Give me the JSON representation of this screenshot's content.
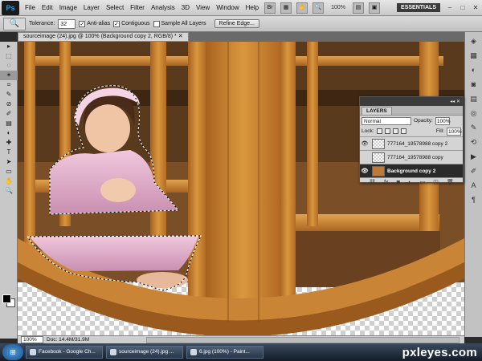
{
  "app": {
    "logo": "Ps",
    "menus": [
      "File",
      "Edit",
      "Image",
      "Layer",
      "Select",
      "Filter",
      "Analysis",
      "3D",
      "View",
      "Window",
      "Help"
    ],
    "zoom_select": "100%",
    "workspace": "ESSENTIALS",
    "win_min": "–",
    "win_max": "□",
    "win_close": "✕",
    "icons": [
      "bridge-icon",
      "mini-bridge-icon",
      "hand-icon",
      "zoom-icon",
      "arrange-icon",
      "screen-mode-icon"
    ]
  },
  "options": {
    "tool_icon": "🔍",
    "tolerance_label": "Tolerance:",
    "tolerance_value": "32",
    "anti_alias_label": "Anti-alias",
    "anti_alias_checked": "✓",
    "contiguous_label": "Contiguous",
    "contiguous_checked": "✓",
    "sample_all_label": "Sample All Layers",
    "sample_all_checked": "",
    "refine_edge": "Refine Edge..."
  },
  "document": {
    "tab_title": "sourceimage (24).jpg @ 100% (Background copy 2, RGB/8) * ✕"
  },
  "tools": [
    "▸",
    "⬚",
    "◌",
    "✶",
    "⌗",
    "✎",
    "⊘",
    "✐",
    "▤",
    "◐",
    "✚",
    "T",
    "➤",
    "▭",
    "✋",
    "🔍"
  ],
  "layers_panel": {
    "collapse": "◂◂ ✕",
    "tab": "LAYERS",
    "blend_mode": "Normal",
    "opacity_label": "Opacity:",
    "opacity_value": "100%",
    "lock_label": "Lock:",
    "fill_label": "Fill:",
    "fill_value": "100%",
    "layers": [
      {
        "name": "777164_19578988 copy 2",
        "visible": "👁"
      },
      {
        "name": "777164_19578988 copy",
        "visible": ""
      },
      {
        "name": "Background copy 2",
        "visible": "👁"
      }
    ],
    "footer_icons": [
      "⛓",
      "fx",
      "◙",
      "◐",
      "▭",
      "◳",
      "🗑"
    ]
  },
  "status": {
    "zoom": "100%",
    "doc": "Doc: 14.4M/31.9M"
  },
  "taskbar": {
    "start": "⊞",
    "tasks": [
      {
        "label": "Facebook - Google Ch..."
      },
      {
        "label": "sourceimage (24).jpg ..."
      },
      {
        "label": "6.jpg (100%) - Paint..."
      }
    ],
    "watermark": "pxleyes.com"
  },
  "colors": {
    "wood_light": "#d9973e",
    "wood_dark": "#8a4f1c",
    "dress": "#e6b8d4",
    "selection": "#ffffff"
  }
}
